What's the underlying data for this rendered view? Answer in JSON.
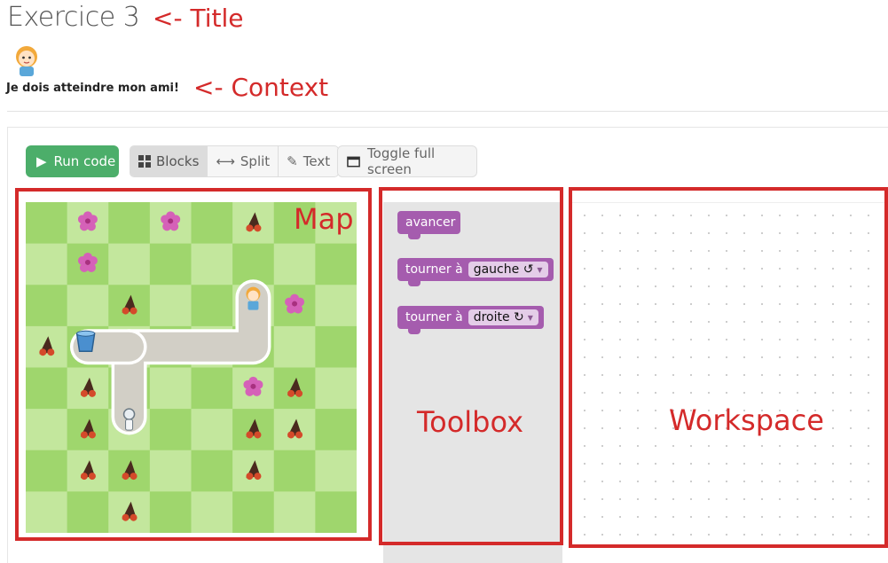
{
  "header": {
    "title": "Exercice 3",
    "title_annotation": "<- Title",
    "context_text": "Je dois atteindre mon ami!",
    "context_annotation": "<- Context"
  },
  "toolbar": {
    "run_label": "Run code",
    "view_modes": [
      "Blocks",
      "Split",
      "Text"
    ],
    "active_view": "Blocks",
    "fullscreen_label": "Toggle full screen"
  },
  "regions": {
    "map_label": "Map",
    "toolbox_label": "Toolbox",
    "workspace_label": "Workspace"
  },
  "toolbox": {
    "blocks": [
      {
        "label": "avancer"
      },
      {
        "label": "tourner à",
        "option": "gauche ↺"
      },
      {
        "label": "tourner à",
        "option": "droite ↻"
      }
    ]
  },
  "map": {
    "rows": 8,
    "cols": 8,
    "colors": {
      "light": "#c3e79d",
      "dark": "#9fd66d",
      "path": "#d2cfc6",
      "path_stroke": "#ffffff"
    },
    "path_cells": [
      [
        7,
        2
      ],
      [
        6,
        2
      ],
      [
        6,
        3
      ],
      [
        6,
        4
      ],
      [
        6,
        5
      ],
      [
        7,
        5
      ],
      [
        8,
        5
      ]
    ],
    "grid_note": "cells as [row, col], 0-indexed"
  },
  "colors": {
    "accent_red": "#d42a2a",
    "run_green": "#4cae6a",
    "block_purple": "#a55cae"
  }
}
